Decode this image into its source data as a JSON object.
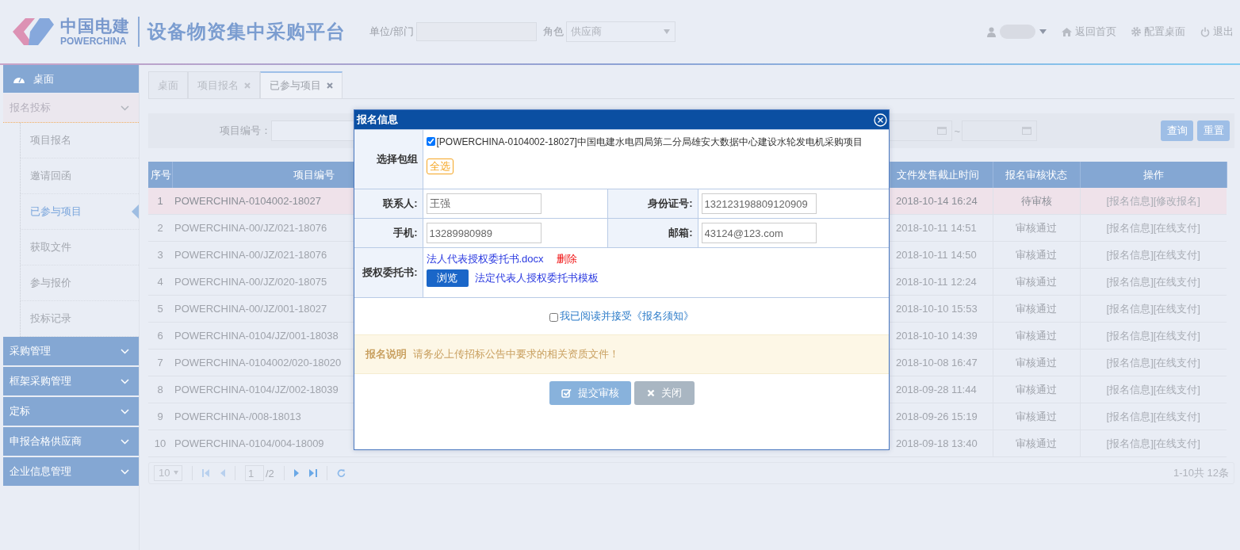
{
  "header": {
    "logo": {
      "name": "中国电建",
      "subname": "POWERCHINA"
    },
    "platform_title": "设备物资集中采购平台",
    "unit_label": "单位/部门",
    "role_label": "角色",
    "role_value": "供应商",
    "links": [
      {
        "label": "返回首页",
        "kind": "home"
      },
      {
        "label": "配置桌面",
        "kind": "gear"
      },
      {
        "label": "退出",
        "kind": "power"
      }
    ]
  },
  "sidebar": {
    "desktop": "桌面",
    "groups": [
      {
        "label": "报名投标",
        "expanded": true,
        "children": [
          {
            "label": "项目报名",
            "selected": false
          },
          {
            "label": "邀请回函",
            "selected": false
          },
          {
            "label": "已参与项目",
            "selected": true
          },
          {
            "label": "获取文件",
            "selected": false
          },
          {
            "label": "参与报价",
            "selected": false
          },
          {
            "label": "投标记录",
            "selected": false
          }
        ]
      },
      {
        "label": "采购管理",
        "expanded": false
      },
      {
        "label": "框架采购管理",
        "expanded": false
      },
      {
        "label": "定标",
        "expanded": false
      },
      {
        "label": "申报合格供应商",
        "expanded": false
      },
      {
        "label": "企业信息管理",
        "expanded": false
      }
    ]
  },
  "tabs": [
    {
      "label": "桌面",
      "closable": false,
      "selected": false
    },
    {
      "label": "项目报名",
      "closable": true,
      "selected": false
    },
    {
      "label": "已参与项目",
      "closable": true,
      "selected": true
    }
  ],
  "search": {
    "label": "项目编号：",
    "date_separator": "~",
    "buttons": [
      "查询",
      "重置"
    ]
  },
  "table": {
    "columns": [
      "序号",
      "项目编号",
      "文件发售截止时间",
      "报名审核状态",
      "操作"
    ],
    "rows": [
      {
        "index": "1",
        "code": "POWERCHINA-0104002-18027",
        "deadline": "2018-10-14 16:24",
        "status": "待审核",
        "actions": [
          "[报名信息]",
          "[修改报名]"
        ],
        "selected": true
      },
      {
        "index": "2",
        "code": "POWERCHINA-00/JZ/021-18076",
        "deadline": "2018-10-11 14:51",
        "status": "审核通过",
        "actions": [
          "[报名信息]",
          "[在线支付]"
        ],
        "selected": false
      },
      {
        "index": "3",
        "code": "POWERCHINA-00/JZ/021-18076",
        "deadline": "2018-10-11 14:50",
        "status": "审核通过",
        "actions": [
          "[报名信息]",
          "[在线支付]"
        ],
        "selected": false
      },
      {
        "index": "4",
        "code": "POWERCHINA-00/JZ/020-18075",
        "deadline": "2018-10-11 12:24",
        "status": "审核通过",
        "actions": [
          "[报名信息]",
          "[在线支付]"
        ],
        "selected": false
      },
      {
        "index": "5",
        "code": "POWERCHINA-00/JZ/001-18027",
        "deadline": "2018-10-10 15:53",
        "status": "审核通过",
        "actions": [
          "[报名信息]",
          "[在线支付]"
        ],
        "selected": false
      },
      {
        "index": "6",
        "code": "POWERCHINA-0104/JZ/001-18038",
        "deadline": "2018-10-10 14:39",
        "status": "审核通过",
        "actions": [
          "[报名信息]",
          "[在线支付]"
        ],
        "selected": false
      },
      {
        "index": "7",
        "code": "POWERCHINA-0104002/020-18020",
        "deadline": "2018-10-08 16:47",
        "status": "审核通过",
        "actions": [
          "[报名信息]",
          "[在线支付]"
        ],
        "selected": false
      },
      {
        "index": "8",
        "code": "POWERCHINA-0104/JZ/002-18039",
        "deadline": "2018-09-28 11:44",
        "status": "审核通过",
        "actions": [
          "[报名信息]",
          "[在线支付]"
        ],
        "selected": false
      },
      {
        "index": "9",
        "code": "POWERCHINA-/008-18013",
        "deadline": "2018-09-26 15:19",
        "status": "审核通过",
        "actions": [
          "[报名信息]",
          "[在线支付]"
        ],
        "selected": false
      },
      {
        "index": "10",
        "code": "POWERCHINA-0104/004-18009",
        "deadline": "2018-09-18 13:40",
        "status": "审核通过",
        "actions": [
          "[报名信息]",
          "[在线支付]"
        ],
        "selected": false
      }
    ]
  },
  "pager": {
    "page_size": "10",
    "page": "1",
    "total_pages": "/2",
    "summary": "1-10共 12条"
  },
  "modal": {
    "title": "报名信息",
    "package_label": "选择包组",
    "package": {
      "checked": true,
      "label": "[POWERCHINA-0104002-18027]中国电建水电四局第二分局雄安大数据中心建设水轮发电机采购项目"
    },
    "select_all": "全选",
    "fields": [
      {
        "label": "联系人:",
        "value": "王强"
      },
      {
        "label": "身份证号:",
        "value": "132123198809120909"
      },
      {
        "label": "手机:",
        "value": "13289980989"
      },
      {
        "label": "邮箱:",
        "value": "43124@123.com"
      }
    ],
    "auth_label": "授权委托书:",
    "file_name": "法人代表授权委托书.docx",
    "delete": "删除",
    "browse": "浏览",
    "template_link": "法定代表人授权委托书模板",
    "agree": {
      "checked": false,
      "label": "我已阅读并接受《报名须知》"
    },
    "notice": {
      "title": "报名说明",
      "text": "请务必上传招标公告中要求的相关资质文件！"
    },
    "buttons": [
      {
        "label": "提交审核",
        "kind": "submit"
      },
      {
        "label": "关闭",
        "kind": "close"
      }
    ]
  }
}
